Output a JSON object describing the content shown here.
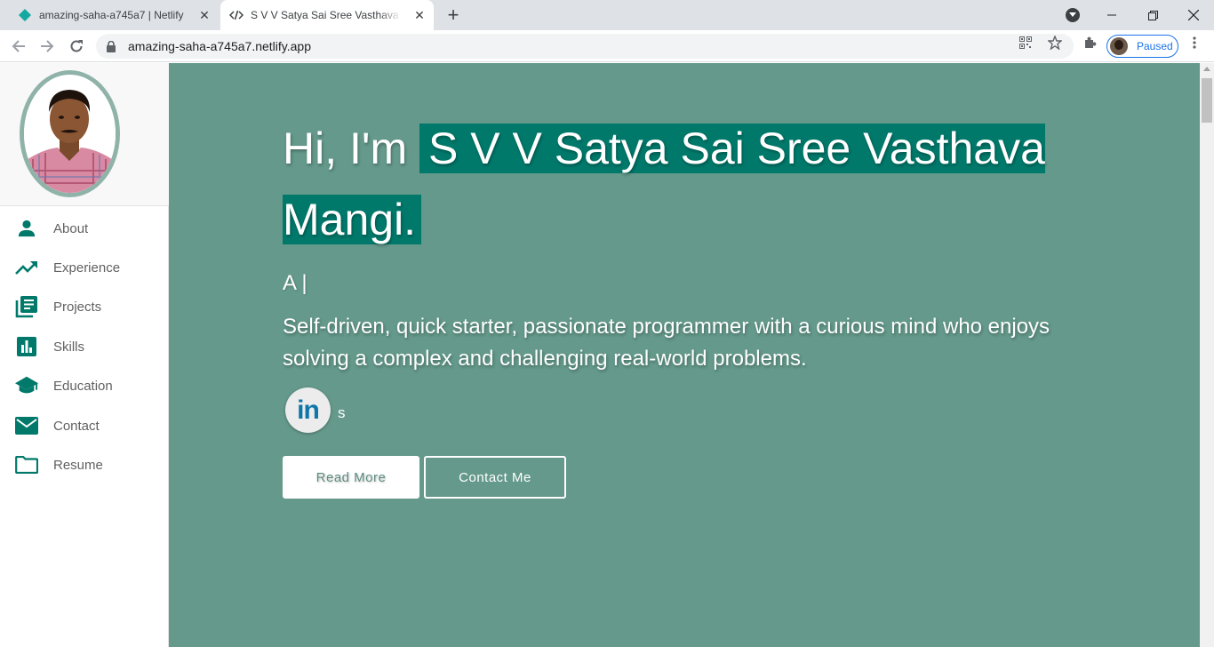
{
  "browser": {
    "tabs": [
      {
        "title": "amazing-saha-a745a7 | Netlify",
        "active": false
      },
      {
        "title": "S V V Satya Sai Sree Vasthava Mangi",
        "active": true
      }
    ],
    "url": "amazing-saha-a745a7.netlify.app",
    "profile_status": "Paused"
  },
  "sidebar": {
    "items": [
      {
        "label": "About",
        "icon": "person-icon"
      },
      {
        "label": "Experience",
        "icon": "trending-up-icon"
      },
      {
        "label": "Projects",
        "icon": "library-books-icon"
      },
      {
        "label": "Skills",
        "icon": "bar-chart-icon"
      },
      {
        "label": "Education",
        "icon": "school-icon"
      },
      {
        "label": "Contact",
        "icon": "mail-icon"
      },
      {
        "label": "Resume",
        "icon": "folder-icon"
      }
    ]
  },
  "hero": {
    "greeting": "Hi, I'm",
    "name": "S V V Satya Sai Sree Vasthava Mangi.",
    "typed_text": "A |",
    "tagline": "Self-driven, quick starter, passionate programmer with a curious mind who enjoys solving a complex and challenging real-world problems.",
    "linkedin_label": "in",
    "social_suffix": "s",
    "read_more": "Read More",
    "contact_me": "Contact Me"
  },
  "colors": {
    "accent": "#00796b",
    "hero_bg": "#64998b",
    "sidebar_icon": "#00796b"
  }
}
